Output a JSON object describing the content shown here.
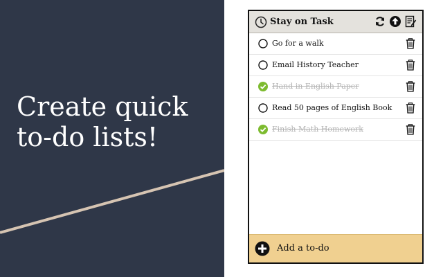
{
  "promo": {
    "headline_line1": "Create quick",
    "headline_line2": "to-do lists!",
    "background_color": "#2f3748",
    "accent_line_color": "#d6c4b2"
  },
  "app": {
    "title": "Stay on Task",
    "header_icons": [
      "clock-icon",
      "refresh-icon",
      "upload-icon",
      "notes-icon"
    ],
    "todos": [
      {
        "text": "Go for a walk",
        "done": false
      },
      {
        "text": "Email History Teacher",
        "done": false
      },
      {
        "text": "Hand in English Paper",
        "done": true
      },
      {
        "text": "Read 50 pages of English Book",
        "done": false
      },
      {
        "text": "Finish Math Homework",
        "done": true
      }
    ],
    "add_label": "Add a to-do",
    "colors": {
      "header_bg": "#e4e2dd",
      "check_green": "#7dbb2f",
      "add_bar_bg": "#f0d090"
    }
  }
}
